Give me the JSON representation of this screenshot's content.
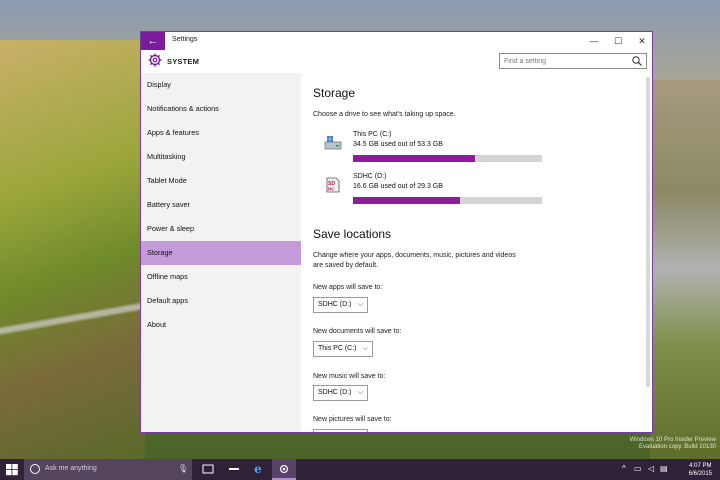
{
  "window": {
    "title": "Settings",
    "back_icon": "←",
    "minimize": "—",
    "maximize": "☐",
    "close": "✕"
  },
  "header": {
    "section": "SYSTEM",
    "search_placeholder": "Find a setting"
  },
  "sidebar": {
    "items": [
      {
        "label": "Display"
      },
      {
        "label": "Notifications & actions"
      },
      {
        "label": "Apps & features"
      },
      {
        "label": "Multitasking"
      },
      {
        "label": "Tablet Mode"
      },
      {
        "label": "Battery saver"
      },
      {
        "label": "Power & sleep"
      },
      {
        "label": "Storage",
        "active": true
      },
      {
        "label": "Offline maps"
      },
      {
        "label": "Default apps"
      },
      {
        "label": "About"
      }
    ]
  },
  "storage": {
    "heading": "Storage",
    "subtitle": "Choose a drive to see what's taking up space.",
    "drives": [
      {
        "name": "This PC (C:)",
        "usage": "34.5 GB used out of 53.3 GB",
        "used_fraction": 0.647
      },
      {
        "name": "SDHC (D:)",
        "usage": "16.6 GB used out of 29.3 GB",
        "used_fraction": 0.567
      }
    ]
  },
  "save_locations": {
    "heading": "Save locations",
    "desc_line1": "Change where your apps, documents, music, pictures and videos",
    "desc_line2": "are saved by default.",
    "fields": [
      {
        "label": "New apps will save to:",
        "value": "SDHC (D:)"
      },
      {
        "label": "New documents will save to:",
        "value": "This PC (C:)"
      },
      {
        "label": "New music will save to:",
        "value": "SDHC (D:)"
      },
      {
        "label": "New pictures will save to:",
        "value": ""
      }
    ]
  },
  "taskbar": {
    "search_placeholder": "Ask me anything",
    "time": "4:07 PM",
    "date": "6/6/2015"
  },
  "watermark": {
    "line1": "Windows 10 Pro Insider Preview",
    "line2": "Evaluation copy. Build 10130"
  },
  "colors": {
    "accent": "#7b1c9f",
    "storage_fill": "#8e1c9a",
    "active_nav": "#c49ad8"
  }
}
